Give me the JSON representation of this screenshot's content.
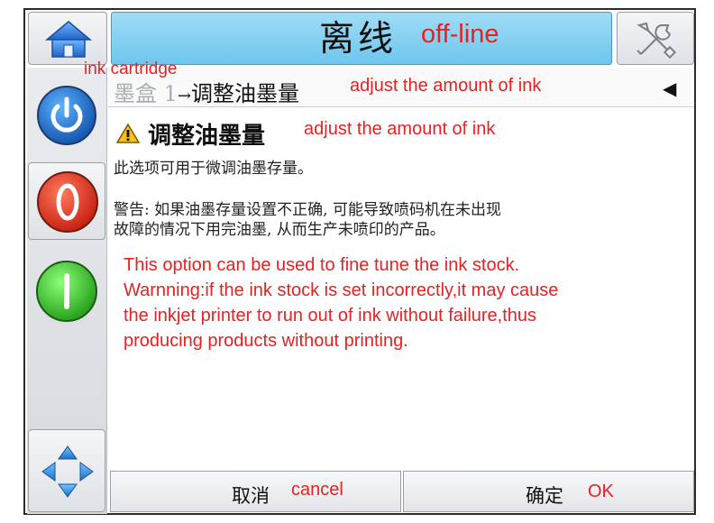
{
  "header": {
    "title_cn": "离线",
    "title_en": "off-line"
  },
  "breadcrumb": {
    "annotation": "ink cartridge",
    "item1": "墨盒 1",
    "arrow": "→",
    "item2": "调整油墨量",
    "item2_en": "adjust the amount of ink",
    "back_glyph": "◀"
  },
  "content": {
    "heading_cn": "调整油墨量",
    "heading_en": "adjust the amount of ink",
    "desc_cn": "此选项可用于微调油墨存量。",
    "warning_cn_line1": "警告:  如果油墨存量设置不正确, 可能导致喷码机在未出现",
    "warning_cn_line2": "故障的情况下用完油墨, 从而生产未喷印的产品。",
    "translation_lines": [
      "This option can be used to fine tune the ink stock.",
      "Warnning:if the ink stock is set incorrectly,it may cause",
      "the inkjet printer to run out of ink without failure,thus",
      "producing products without printing."
    ]
  },
  "footer": {
    "cancel_cn": "取消",
    "cancel_en": "cancel",
    "ok_cn": "确定",
    "ok_en": "OK"
  },
  "icons": {
    "home": "home-icon",
    "tools": "tools-icon",
    "power": "power-icon",
    "stop": "stop-icon",
    "start": "start-icon",
    "navigate": "navigate-arrows-icon",
    "warning": "warning-icon"
  },
  "colors": {
    "title_bar": "#7fd0f2",
    "annotation_red": "#e52222",
    "power_blue": "#1a73d0",
    "stop_red": "#e8321d",
    "start_green": "#34c424"
  }
}
